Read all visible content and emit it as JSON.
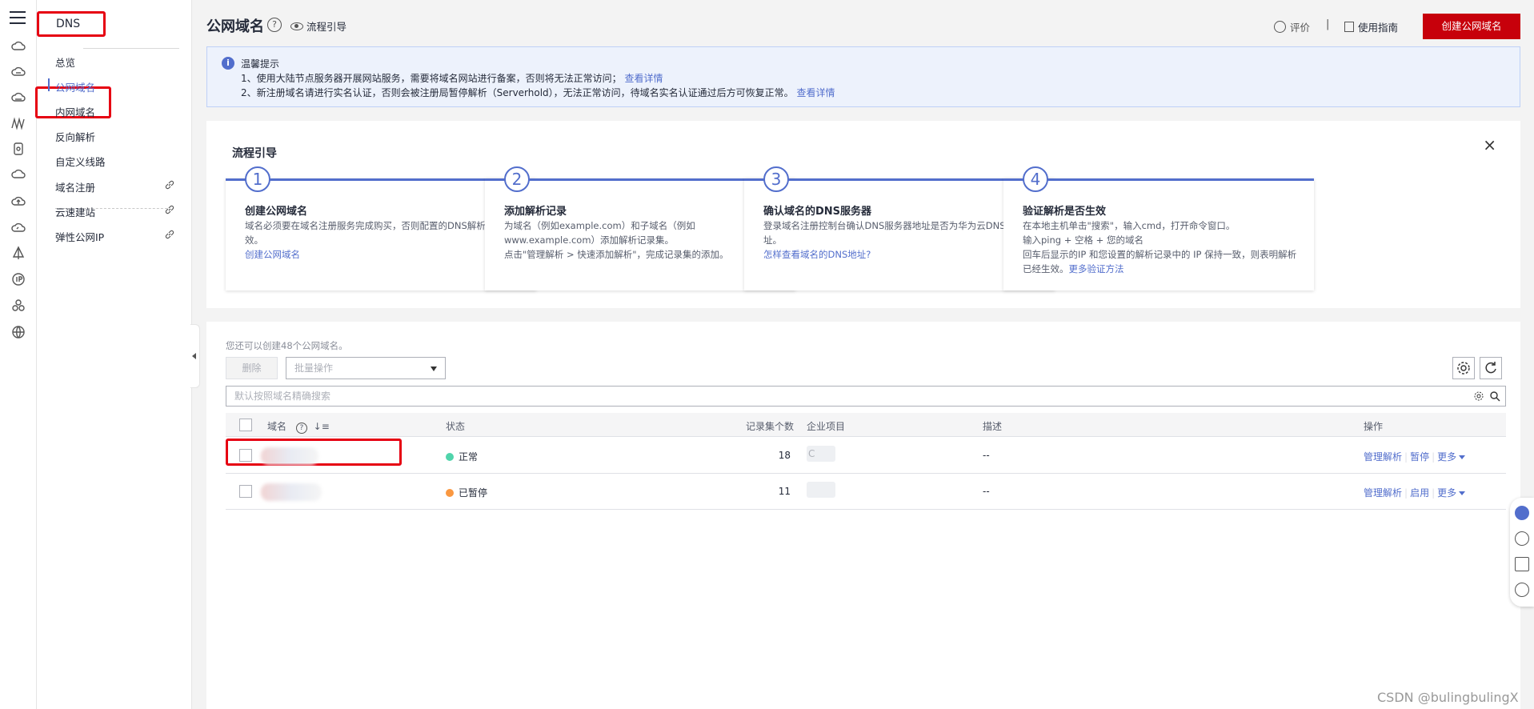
{
  "rail": {
    "icons": [
      "menu-icon",
      "cloud-compute-icon",
      "cloud-icon",
      "cloud-storage-icon",
      "network-icon",
      "database-icon",
      "cloud-outline-icon",
      "cloud-upload-icon",
      "cloud-analytics-icon",
      "iot-icon",
      "ip-icon",
      "cluster-icon",
      "globe-icon"
    ]
  },
  "subnav": {
    "service": "DNS",
    "items": [
      {
        "label": "总览"
      },
      {
        "label": "公网域名"
      },
      {
        "label": "内网域名"
      },
      {
        "label": "反向解析"
      },
      {
        "label": "自定义线路"
      },
      {
        "label": "域名注册"
      },
      {
        "label": "云速建站"
      },
      {
        "label": "弹性公网IP"
      }
    ]
  },
  "header": {
    "title": "公网域名",
    "help_icon": "?",
    "guide": "流程引导",
    "rate": "评价",
    "divider": "|",
    "usage_guide": "使用指南",
    "create_button": "创建公网域名"
  },
  "notice": {
    "title": "温馨提示",
    "line1": "1、使用大陆节点服务器开展网站服务，需要将域名网站进行备案，否则将无法正常访问；",
    "line1_link": "查看详情",
    "line2": "2、新注册域名请进行实名认证，否则会被注册局暂停解析（Serverhold），无法正常访问，待域名实名认证通过后方可恢复正常。",
    "line2_link": "查看详情"
  },
  "flow": {
    "title": "流程引导",
    "close": "×",
    "steps": [
      {
        "num": "1",
        "title": "创建公网域名",
        "desc": "域名必须要在域名注册服务完成购买，否则配置的DNS解析不会生效。",
        "link": "创建公网域名"
      },
      {
        "num": "2",
        "title": "添加解析记录",
        "desc": "为域名（例如example.com）和子域名（例如www.example.com）添加解析记录集。",
        "desc2": "点击\"管理解析 > 快速添加解析\"，完成记录集的添加。",
        "link": ""
      },
      {
        "num": "3",
        "title": "确认域名的DNS服务器",
        "desc": "登录域名注册控制台确认DNS服务器地址是否为华为云DNS服务器地址。",
        "link": "怎样查看域名的DNS地址?"
      },
      {
        "num": "4",
        "title": "验证解析是否生效",
        "desc": "在本地主机单击\"搜索\"，输入cmd，打开命令窗口。",
        "desc2": "输入ping + 空格 + 您的域名",
        "desc3": "回车后显示的IP 和您设置的解析记录中的 IP 保持一致，则表明解析已经生效。",
        "link": "更多验证方法"
      }
    ]
  },
  "list": {
    "quota": "您还可以创建48个公网域名。",
    "delete": "删除",
    "batch_placeholder": "批量操作",
    "search_placeholder": "默认按照域名精确搜索",
    "columns": {
      "name": "域名",
      "status": "状态",
      "records": "记录集个数",
      "project": "企业项目",
      "desc": "描述",
      "ops": "操作"
    },
    "rows": [
      {
        "status": "正常",
        "status_color": "#50d4ab",
        "records": "18",
        "project": "C",
        "desc": "--",
        "op1": "管理解析",
        "op2": "暂停",
        "op3": "更多"
      },
      {
        "status": "已暂停",
        "status_color": "#fa9841",
        "records": "11",
        "project": "",
        "desc": "--",
        "op1": "管理解析",
        "op2": "启用",
        "op3": "更多"
      }
    ]
  },
  "watermark": "CSDN @bulingbulingX",
  "colors": {
    "accent": "#526ecc",
    "brand_red": "#c7000b",
    "highlight_box": "#e60012"
  }
}
